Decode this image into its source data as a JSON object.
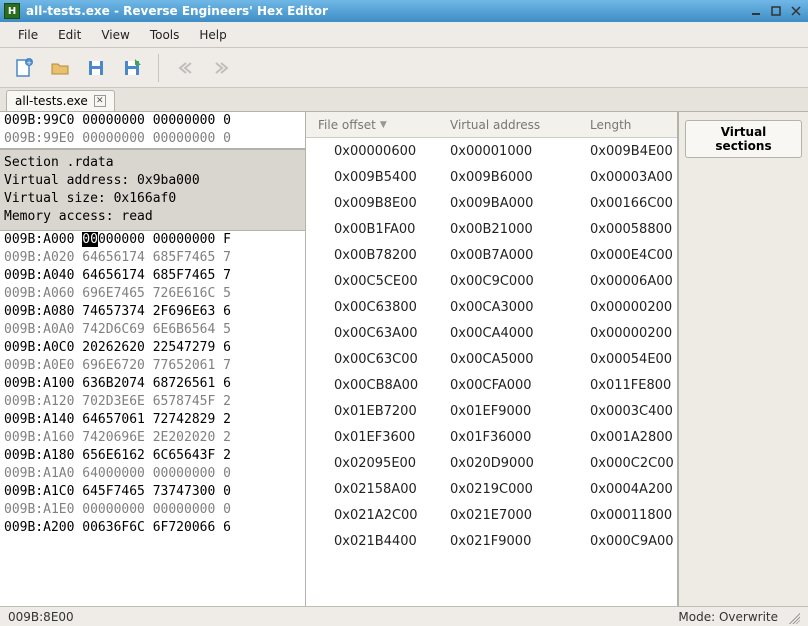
{
  "window": {
    "title": "all-tests.exe - Reverse Engineers' Hex Editor"
  },
  "menu": {
    "file": "File",
    "edit": "Edit",
    "view": "View",
    "tools": "Tools",
    "help": "Help"
  },
  "tabs": {
    "tab0": {
      "label": "all-tests.exe"
    }
  },
  "hex": {
    "top": [
      {
        "addr": "009B:99C0",
        "bytes": "00000000 00000000 0",
        "gray": false
      },
      {
        "addr": "009B:99E0",
        "bytes": "00000000 00000000 0",
        "gray": true
      }
    ],
    "section": {
      "line1": "Section .rdata",
      "line2": "Virtual address: 0x9ba000",
      "line3": "Virtual size: 0x166af0",
      "line4": "Memory access: read"
    },
    "rows": [
      {
        "addr": "009B:A000",
        "pre": "",
        "hi": "00",
        "post": "000000 00000000 F",
        "gray": false
      },
      {
        "addr": "009B:A020",
        "pre": "64656174 685F7465 7",
        "hi": "",
        "post": "",
        "gray": true
      },
      {
        "addr": "009B:A040",
        "pre": "64656174 685F7465 7",
        "hi": "",
        "post": "",
        "gray": false
      },
      {
        "addr": "009B:A060",
        "pre": "696E7465 726E616C 5",
        "hi": "",
        "post": "",
        "gray": true
      },
      {
        "addr": "009B:A080",
        "pre": "74657374 2F696E63 6",
        "hi": "",
        "post": "",
        "gray": false
      },
      {
        "addr": "009B:A0A0",
        "pre": "742D6C69 6E6B6564 5",
        "hi": "",
        "post": "",
        "gray": true
      },
      {
        "addr": "009B:A0C0",
        "pre": "20262620 22547279 6",
        "hi": "",
        "post": "",
        "gray": false
      },
      {
        "addr": "009B:A0E0",
        "pre": "696E6720 77652061 7",
        "hi": "",
        "post": "",
        "gray": true
      },
      {
        "addr": "009B:A100",
        "pre": "636B2074 68726561 6",
        "hi": "",
        "post": "",
        "gray": false
      },
      {
        "addr": "009B:A120",
        "pre": "702D3E6E 6578745F 2",
        "hi": "",
        "post": "",
        "gray": true
      },
      {
        "addr": "009B:A140",
        "pre": "64657061 72742829 2",
        "hi": "",
        "post": "",
        "gray": false
      },
      {
        "addr": "009B:A160",
        "pre": "7420696E 2E202020 2",
        "hi": "",
        "post": "",
        "gray": true
      },
      {
        "addr": "009B:A180",
        "pre": "656E6162 6C65643F 2",
        "hi": "",
        "post": "",
        "gray": false
      },
      {
        "addr": "009B:A1A0",
        "pre": "64000000 00000000 0",
        "hi": "",
        "post": "",
        "gray": true
      },
      {
        "addr": "009B:A1C0",
        "pre": "645F7465 73747300 0",
        "hi": "",
        "post": "",
        "gray": false
      },
      {
        "addr": "009B:A1E0",
        "pre": "00000000 00000000 0",
        "hi": "",
        "post": "",
        "gray": true
      },
      {
        "addr": "009B:A200",
        "pre": "00636F6C 6F720066 6",
        "hi": "",
        "post": "",
        "gray": false
      }
    ]
  },
  "vtable": {
    "headers": {
      "c1": "File offset",
      "c2": "Virtual address",
      "c3": "Length"
    },
    "rows": [
      {
        "o": "0x00000600",
        "v": "0x00001000",
        "l": "0x009B4E00"
      },
      {
        "o": "0x009B5400",
        "v": "0x009B6000",
        "l": "0x00003A00"
      },
      {
        "o": "0x009B8E00",
        "v": "0x009BA000",
        "l": "0x00166C00"
      },
      {
        "o": "0x00B1FA00",
        "v": "0x00B21000",
        "l": "0x00058800"
      },
      {
        "o": "0x00B78200",
        "v": "0x00B7A000",
        "l": "0x000E4C00"
      },
      {
        "o": "0x00C5CE00",
        "v": "0x00C9C000",
        "l": "0x00006A00"
      },
      {
        "o": "0x00C63800",
        "v": "0x00CA3000",
        "l": "0x00000200"
      },
      {
        "o": "0x00C63A00",
        "v": "0x00CA4000",
        "l": "0x00000200"
      },
      {
        "o": "0x00C63C00",
        "v": "0x00CA5000",
        "l": "0x00054E00"
      },
      {
        "o": "0x00CB8A00",
        "v": "0x00CFA000",
        "l": "0x011FE800"
      },
      {
        "o": "0x01EB7200",
        "v": "0x01EF9000",
        "l": "0x0003C400"
      },
      {
        "o": "0x01EF3600",
        "v": "0x01F36000",
        "l": "0x001A2800"
      },
      {
        "o": "0x02095E00",
        "v": "0x020D9000",
        "l": "0x000C2C00"
      },
      {
        "o": "0x02158A00",
        "v": "0x0219C000",
        "l": "0x0004A200"
      },
      {
        "o": "0x021A2C00",
        "v": "0x021E7000",
        "l": "0x00011800"
      },
      {
        "o": "0x021B4400",
        "v": "0x021F9000",
        "l": "0x000C9A00"
      }
    ]
  },
  "rightpane": {
    "tab_label": "Virtual sections"
  },
  "status": {
    "offset": "009B:8E00",
    "mode": "Mode: Overwrite"
  }
}
